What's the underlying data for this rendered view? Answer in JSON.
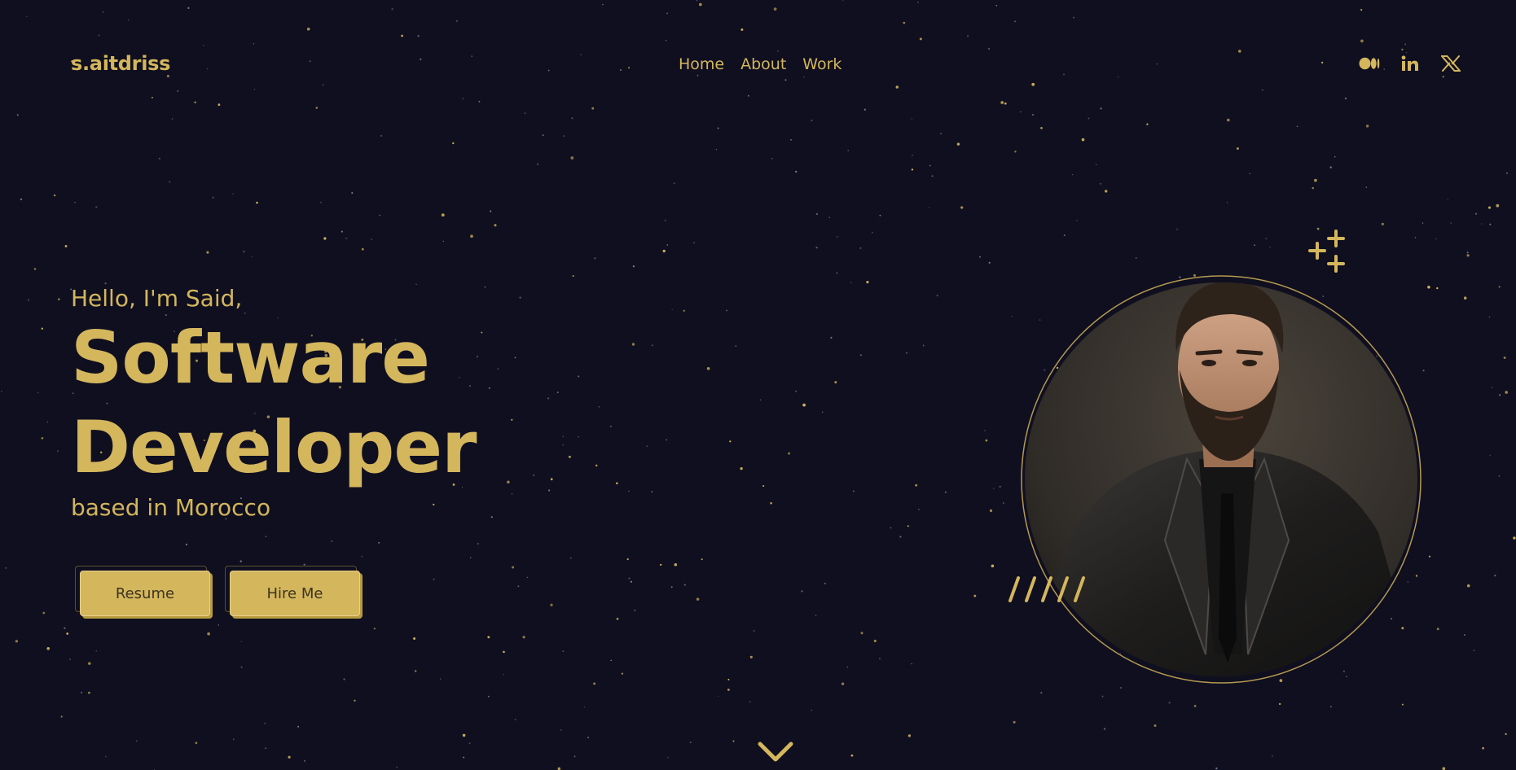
{
  "header": {
    "logo": "s.aitdriss",
    "nav": [
      "Home",
      "About",
      "Work"
    ],
    "socials": [
      "medium-icon",
      "linkedin-icon",
      "x-twitter-icon"
    ]
  },
  "hero": {
    "greeting": "Hello, I'm Said,",
    "title_line1": "Software",
    "title_line2": "Developer",
    "subline": "based in Morocco",
    "buttons": {
      "resume": "Resume",
      "hire": "Hire Me"
    }
  },
  "decor": {
    "portrait": "portrait-image",
    "plus_cluster": "plus-cluster-icon",
    "slashes": "slashes-decoration",
    "scroll": "chevron-down-icon"
  },
  "colors": {
    "background": "#0f0f20",
    "accent": "#d4b65c",
    "button_text": "#3d3420"
  }
}
